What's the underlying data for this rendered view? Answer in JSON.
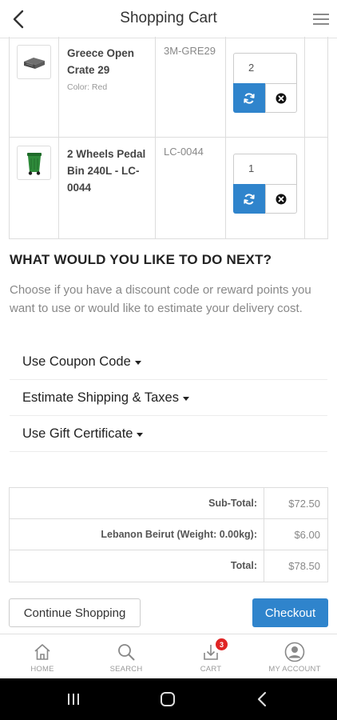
{
  "header": {
    "title": "Shopping Cart",
    "back_icon": "chevron-left-icon",
    "menu_icon": "hamburger-menu-icon"
  },
  "cart": {
    "items": [
      {
        "name": "Greece Open Crate 29",
        "option": "Color: Red",
        "model": "3M-GRE29",
        "quantity": "2",
        "image": "crate-thumbnail"
      },
      {
        "name": "2 Wheels Pedal Bin 240L - LC-0044",
        "option": "",
        "model": "LC-0044",
        "quantity": "1",
        "image": "bin-thumbnail"
      }
    ]
  },
  "next": {
    "heading": "WHAT WOULD YOU LIKE TO DO NEXT?",
    "description": "Choose if you have a discount code or reward points you want to use or would like to estimate your delivery cost.",
    "options": [
      {
        "label": "Use Coupon Code"
      },
      {
        "label": "Estimate Shipping & Taxes"
      },
      {
        "label": "Use Gift Certificate"
      }
    ]
  },
  "totals": [
    {
      "label": "Sub-Total:",
      "value": "$72.50"
    },
    {
      "label": "Lebanon Beirut (Weight: 0.00kg):",
      "value": "$6.00"
    },
    {
      "label": "Total:",
      "value": "$78.50"
    }
  ],
  "actions": {
    "continue_label": "Continue Shopping",
    "checkout_label": "Checkout"
  },
  "tabbar": {
    "home": "HOME",
    "search": "SEARCH",
    "cart": "CART",
    "cart_badge": "3",
    "account": "MY ACCOUNT"
  },
  "colors": {
    "accent": "#2f84cc",
    "badge": "#e02424"
  }
}
